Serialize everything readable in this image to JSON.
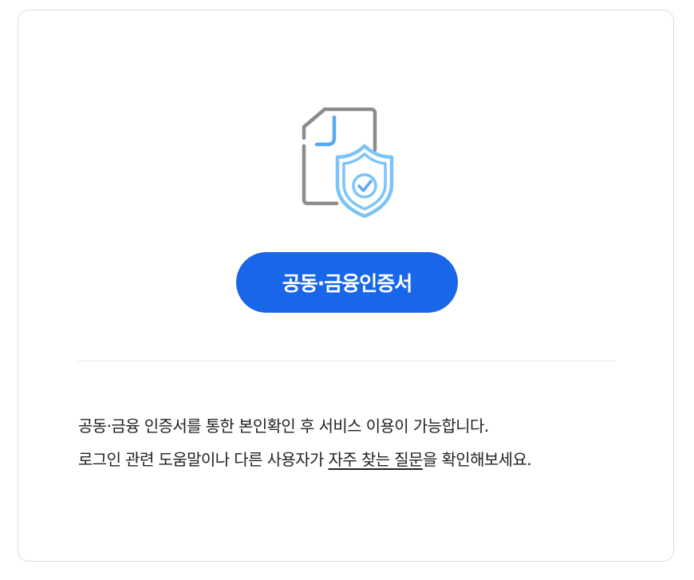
{
  "icon": {
    "name": "certificate-shield-icon",
    "gray": "#8c8c8c",
    "blue": "#7cc4f8",
    "accent_blue": "#59a9f2"
  },
  "cert_button": {
    "label": "공동·금융인증서",
    "color": "#1a66e8"
  },
  "description": {
    "line1": "공동·금융 인증서를 통한 본인확인 후 서비스 이용이 가능합니다.",
    "line2_before": "로그인 관련 도움말이나 다른 사용자가 ",
    "line2_link": "자주 찾는 질문",
    "line2_after": "을 확인해보세요."
  }
}
